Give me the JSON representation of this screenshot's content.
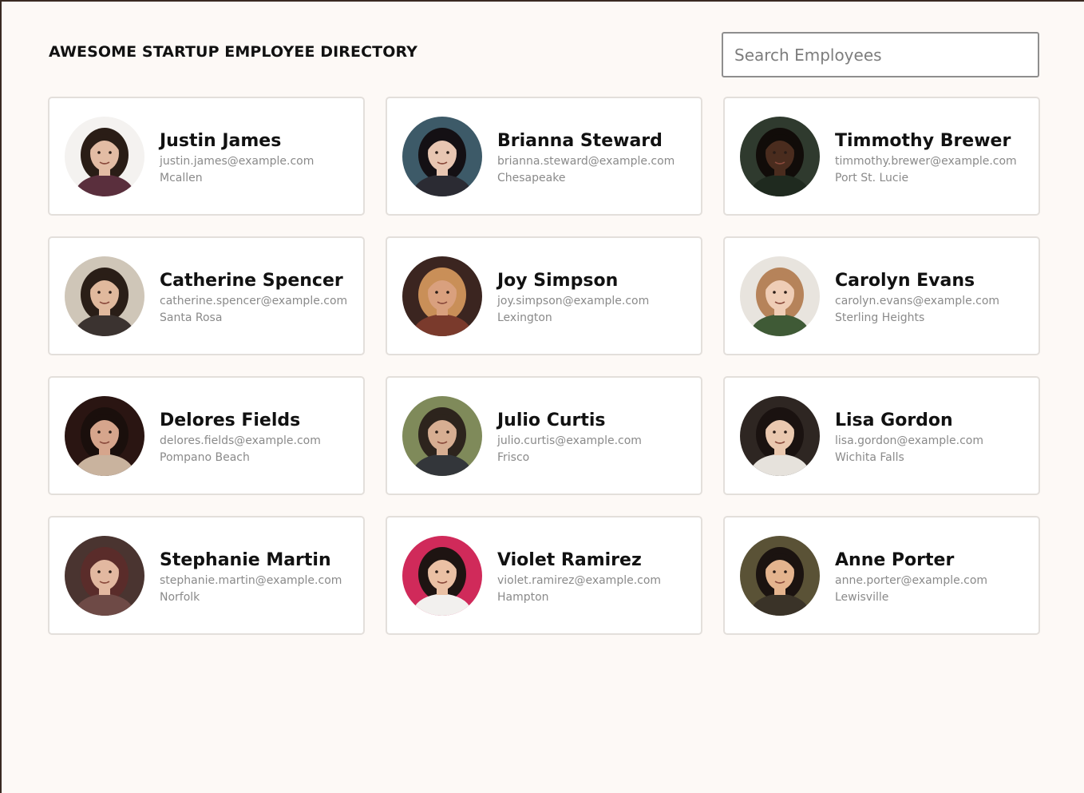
{
  "header": {
    "title": "AWESOME STARTUP EMPLOYEE DIRECTORY"
  },
  "search": {
    "placeholder": "Search Employees",
    "value": ""
  },
  "employees": [
    {
      "name": "Justin James",
      "email": "justin.james@example.com",
      "city": "Mcallen",
      "bg": "#f4f2f0",
      "skin": "#e3bca4",
      "hair": "#2a1d16",
      "shirt": "#5a2f3d"
    },
    {
      "name": "Brianna Steward",
      "email": "brianna.steward@example.com",
      "city": "Chesapeake",
      "bg": "#3d5a68",
      "skin": "#e8c6b2",
      "hair": "#141014",
      "shirt": "#2b2b33"
    },
    {
      "name": "Timmothy Brewer",
      "email": "timmothy.brewer@example.com",
      "city": "Port St. Lucie",
      "bg": "#2f3a2e",
      "skin": "#4a2c1e",
      "hair": "#110c09",
      "shirt": "#1f2a1f"
    },
    {
      "name": "Catherine Spencer",
      "email": "catherine.spencer@example.com",
      "city": "Santa Rosa",
      "bg": "#cfc6b8",
      "skin": "#e0b99d",
      "hair": "#2a1e17",
      "shirt": "#3b3330"
    },
    {
      "name": "Joy Simpson",
      "email": "joy.simpson@example.com",
      "city": "Lexington",
      "bg": "#3b2520",
      "skin": "#d9a07e",
      "hair": "#c98f58",
      "shirt": "#7a3a2c"
    },
    {
      "name": "Carolyn Evans",
      "email": "carolyn.evans@example.com",
      "city": "Sterling Heights",
      "bg": "#e8e4de",
      "skin": "#efcdb6",
      "hair": "#b6835a",
      "shirt": "#3f5a36"
    },
    {
      "name": "Delores Fields",
      "email": "delores.fields@example.com",
      "city": "Pompano Beach",
      "bg": "#2a1512",
      "skin": "#d6a58c",
      "hair": "#1a0f0c",
      "shirt": "#c9b39e"
    },
    {
      "name": "Julio Curtis",
      "email": "julio.curtis@example.com",
      "city": "Frisco",
      "bg": "#7f8a5a",
      "skin": "#d7ae92",
      "hair": "#2d241d",
      "shirt": "#33363a"
    },
    {
      "name": "Lisa Gordon",
      "email": "lisa.gordon@example.com",
      "city": "Wichita Falls",
      "bg": "#2e2622",
      "skin": "#eac8af",
      "hair": "#1a1210",
      "shirt": "#e6e2dc"
    },
    {
      "name": "Stephanie Martin",
      "email": "stephanie.martin@example.com",
      "city": "Norfolk",
      "bg": "#4a3430",
      "skin": "#e2b8a0",
      "hair": "#5a2c2a",
      "shirt": "#6e4a46"
    },
    {
      "name": "Violet Ramirez",
      "email": "violet.ramirez@example.com",
      "city": "Hampton",
      "bg": "#d02a5a",
      "skin": "#eac0a4",
      "hair": "#1e1412",
      "shirt": "#f2f0ee"
    },
    {
      "name": "Anne Porter",
      "email": "anne.porter@example.com",
      "city": "Lewisville",
      "bg": "#5a5236",
      "skin": "#e4b48e",
      "hair": "#1b1310",
      "shirt": "#3a3328"
    }
  ]
}
